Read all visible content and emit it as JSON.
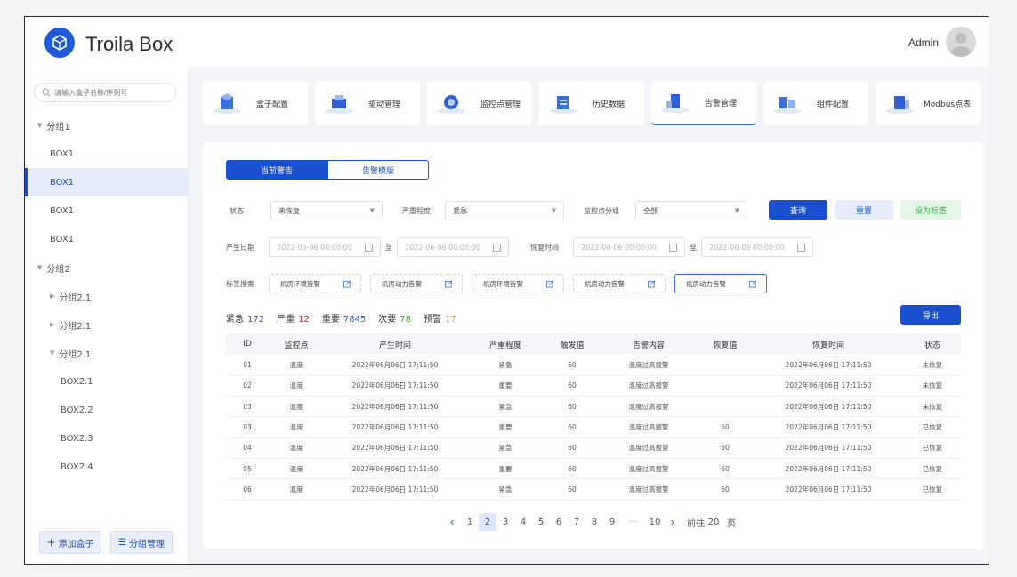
{
  "header": {
    "brand": "Troila Box",
    "user": "Admin"
  },
  "sidebar": {
    "search_placeholder": "请输入盒子名称/序列号",
    "tree": [
      {
        "label": "分组1",
        "type": "group",
        "expanded": true
      },
      {
        "label": "BOX1",
        "type": "box"
      },
      {
        "label": "BOX1",
        "type": "box",
        "active": true
      },
      {
        "label": "BOX1",
        "type": "box"
      },
      {
        "label": "BOX1",
        "type": "box"
      },
      {
        "label": "分组2",
        "type": "group",
        "expanded": true
      },
      {
        "label": "分组2.1",
        "type": "subgroup",
        "expanded": false
      },
      {
        "label": "分组2.1",
        "type": "subgroup",
        "expanded": false
      },
      {
        "label": "分组2.1",
        "type": "subgroup",
        "expanded": true
      },
      {
        "label": "BOX2.1",
        "type": "box"
      },
      {
        "label": "BOX2.2",
        "type": "box"
      },
      {
        "label": "BOX2.3",
        "type": "box"
      },
      {
        "label": "BOX2.4",
        "type": "box"
      }
    ],
    "add_box": "添加盒子",
    "group_manage": "分组管理"
  },
  "nav_tabs": [
    {
      "label": "盒子配置"
    },
    {
      "label": "驱动管理"
    },
    {
      "label": "监控点管理"
    },
    {
      "label": "历史数据"
    },
    {
      "label": "告警管理",
      "active": true
    },
    {
      "label": "组件配置"
    },
    {
      "label": "Modbus点表"
    }
  ],
  "alarm": {
    "tab_current": "当前警告",
    "tab_template": "告警模版",
    "filters": {
      "status_label": "状态",
      "status_value": "未恢复",
      "severity_label": "严重程度",
      "severity_value": "紧急",
      "group_label": "监控点分组",
      "group_value": "全部",
      "gen_date_label": "产生日期",
      "recover_time_label": "恢复时间",
      "date_placeholder": "2022-06-06 00:00:00",
      "to": "至",
      "tag_search_label": "标签搜索"
    },
    "buttons": {
      "query": "查询",
      "reset": "重置",
      "set_tag": "设为标签",
      "export": "导出"
    },
    "tags": [
      "机房环境告警",
      "机房动力告警",
      "机房环境告警",
      "机房动力告警",
      "机房动力告警"
    ],
    "counts": [
      {
        "label": "紧急",
        "value": "172",
        "color": "#2f5fd9"
      },
      {
        "label": "严重",
        "value": "12",
        "color": "#e02020"
      },
      {
        "label": "重要",
        "value": "7845",
        "color": "#2f5fd9"
      },
      {
        "label": "次要",
        "value": "78",
        "color": "#48b33f"
      },
      {
        "label": "预警",
        "value": "17",
        "color": "#f0a020"
      }
    ],
    "columns": [
      "ID",
      "监控点",
      "产生时间",
      "严重程度",
      "触发值",
      "告警内容",
      "恢复值",
      "恢复时间",
      "状态"
    ],
    "rows": [
      [
        "01",
        "温度",
        "2022年06月06日 17:11:50",
        "紧急",
        "60",
        "温度过高报警",
        "",
        "2022年06月06日 17:11:50",
        "未恢复"
      ],
      [
        "02",
        "温度",
        "2022年06月06日 17:11:50",
        "重要",
        "60",
        "温度过高报警",
        "",
        "2022年06月06日 17:11:50",
        "未恢复"
      ],
      [
        "03",
        "温度",
        "2022年06月06日 17:11:50",
        "紧急",
        "60",
        "温度过高报警",
        "",
        "2022年06月06日 17:11:50",
        "未恢复"
      ],
      [
        "03",
        "温度",
        "2022年06月06日 17:11:50",
        "重要",
        "60",
        "温度过高报警",
        "60",
        "2022年06月06日 17:11:50",
        "已恢复"
      ],
      [
        "04",
        "温度",
        "2022年06月06日 17:11:50",
        "紧急",
        "60",
        "温度过高报警",
        "60",
        "2022年06月06日 17:11:50",
        "已恢复"
      ],
      [
        "05",
        "温度",
        "2022年06月06日 17:11:50",
        "重要",
        "60",
        "温度过高报警",
        "60",
        "2022年06月06日 17:11:50",
        "已恢复"
      ],
      [
        "06",
        "温度",
        "2022年06月06日 17:11:50",
        "紧急",
        "60",
        "温度过高报警",
        "60",
        "2022年06月06日 17:11:50",
        "已恢复"
      ]
    ],
    "pagination": {
      "prev": "‹",
      "pages": [
        "1",
        "2",
        "3",
        "4",
        "5",
        "6",
        "7",
        "8",
        "9",
        "···",
        "10"
      ],
      "current": "2",
      "next": "›",
      "goto_prefix": "前往",
      "goto_value": "20",
      "goto_suffix": "页"
    }
  },
  "colors": {
    "primary": "#1a4fd0",
    "light": "#e6ecfa",
    "green_btn_bg": "#e4f6e6",
    "green_btn_text": "#3aa84a"
  }
}
